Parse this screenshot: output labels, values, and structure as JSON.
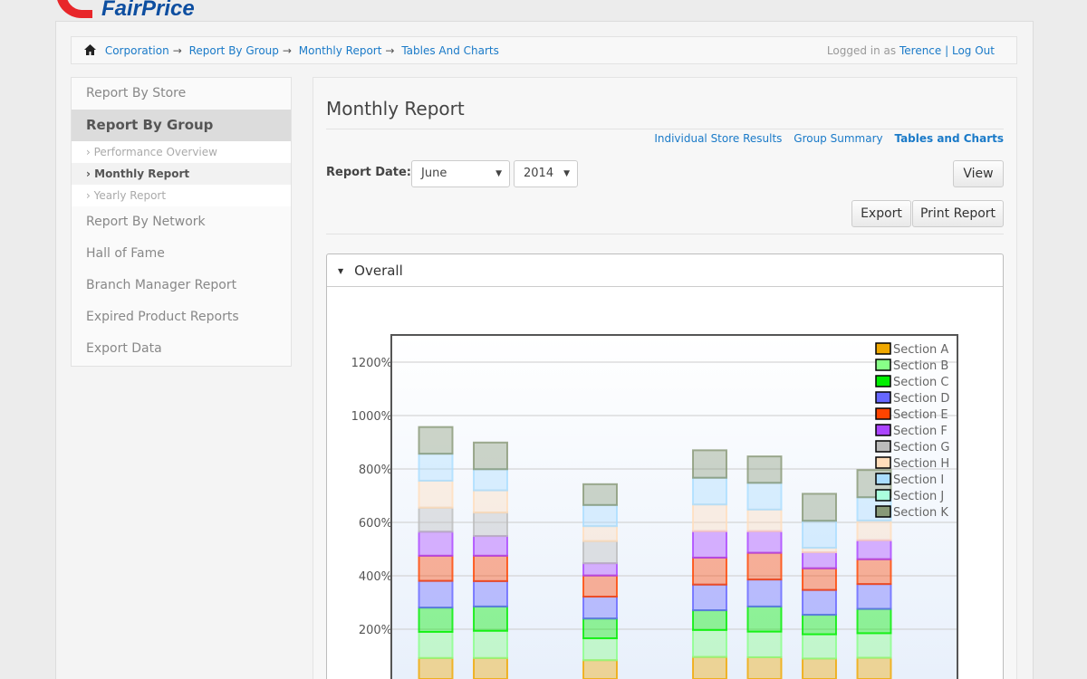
{
  "logo": {
    "text": "FairPrice"
  },
  "breadcrumb": {
    "items": [
      "Corporation",
      "Report By Group",
      "Monthly Report",
      "Tables And Charts"
    ],
    "separator": "→",
    "logged_in_prefix": "Logged in as",
    "user": "Terence",
    "divider": "|",
    "logout": "Log Out"
  },
  "sidebar": {
    "items": [
      {
        "label": "Report By Store"
      },
      {
        "label": "Report By Group",
        "active": true,
        "children": [
          {
            "label": "› Performance Overview"
          },
          {
            "label": "› Monthly Report",
            "current": true
          },
          {
            "label": "› Yearly Report"
          }
        ]
      },
      {
        "label": "Report By Network"
      },
      {
        "label": "Hall of Fame"
      },
      {
        "label": "Branch Manager Report"
      },
      {
        "label": "Expired Product Reports"
      },
      {
        "label": "Export Data"
      }
    ]
  },
  "main": {
    "title": "Monthly Report",
    "links": [
      "Individual Store Results",
      "Group Summary",
      "Tables and Charts"
    ],
    "report_date_label": "Report Date:",
    "month": "June",
    "year": "2014",
    "view": "View",
    "export": "Export",
    "print": "Print Report",
    "panel_title": "Overall"
  },
  "chart_data": {
    "type": "bar",
    "stacked": true,
    "ylim": [
      0,
      1300
    ],
    "yticks": [
      "200%",
      "400%",
      "600%",
      "800%",
      "1000%",
      "1200%"
    ],
    "grid": true,
    "legend": "top-right",
    "series": [
      {
        "name": "Section A",
        "color": "#f0a800",
        "values": [
          92,
          92,
          null,
          84,
          null,
          96,
          95,
          90,
          93
        ]
      },
      {
        "name": "Section B",
        "color": "#88ff88",
        "values": [
          98,
          102,
          null,
          82,
          null,
          101,
          96,
          91,
          92
        ]
      },
      {
        "name": "Section C",
        "color": "#00ee00",
        "values": [
          91,
          91,
          null,
          74,
          null,
          74,
          94,
          73,
          91
        ]
      },
      {
        "name": "Section D",
        "color": "#6666ff",
        "values": [
          100,
          95,
          null,
          82,
          null,
          96,
          101,
          93,
          93
        ]
      },
      {
        "name": "Section E",
        "color": "#ff4400",
        "values": [
          94,
          95,
          null,
          79,
          null,
          101,
          100,
          81,
          93
        ]
      },
      {
        "name": "Section F",
        "color": "#aa44ff",
        "values": [
          90,
          74,
          null,
          46,
          null,
          99,
          81,
          60,
          71
        ]
      },
      {
        "name": "Section G",
        "color": "#bbbbbb",
        "values": [
          90,
          88,
          null,
          83,
          null,
          0,
          0,
          0,
          0
        ]
      },
      {
        "name": "Section H",
        "color": "#ffddbb",
        "values": [
          101,
          83,
          null,
          56,
          null,
          100,
          81,
          17,
          74
        ]
      },
      {
        "name": "Section I",
        "color": "#aaddff",
        "values": [
          101,
          79,
          null,
          79,
          null,
          100,
          100,
          101,
          87
        ]
      },
      {
        "name": "Section J",
        "color": "#aaffdd",
        "values": [
          0,
          0,
          null,
          0,
          null,
          0,
          0,
          0,
          0
        ]
      },
      {
        "name": "Section K",
        "color": "#889977",
        "values": [
          100,
          100,
          null,
          78,
          null,
          103,
          99,
          101,
          102
        ]
      }
    ]
  }
}
